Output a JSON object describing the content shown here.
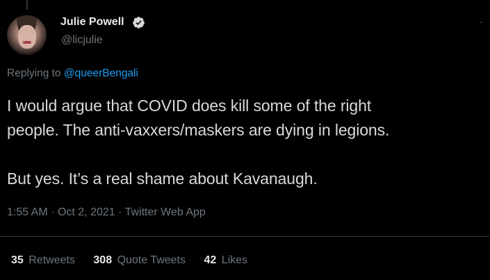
{
  "author": {
    "display_name": "Julie Powell",
    "handle": "@licjulie",
    "verified": true
  },
  "reply": {
    "prefix": "Replying to",
    "mention": "@queerBengali"
  },
  "tweet": {
    "line1": "I would argue that COVID does kill some of the right",
    "line2": "people. The anti-vaxxers/maskers are dying in legions.",
    "line3": "But yes. It’s a real shame about Kavanaugh."
  },
  "meta": {
    "time": "1:55 AM",
    "separator": "·",
    "date": "Oct 2, 2021",
    "source": "Twitter Web App"
  },
  "stats": {
    "retweets_count": "35",
    "retweets_label": "Retweets",
    "quotes_count": "308",
    "quotes_label": "Quote Tweets",
    "likes_count": "42",
    "likes_label": "Likes"
  },
  "colors": {
    "background": "#000000",
    "text": "#d9d9d9",
    "muted": "#6e767d",
    "accent": "#1d9bf0"
  },
  "icons": {
    "verified": "verified-badge-icon",
    "more": "more-options-icon"
  }
}
